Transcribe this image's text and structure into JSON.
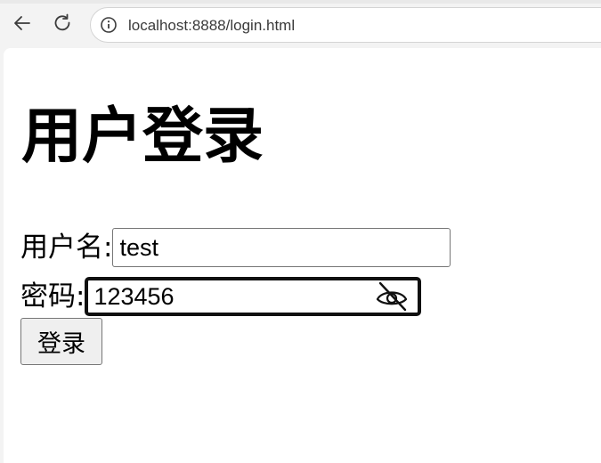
{
  "browser": {
    "url": "localhost:8888/login.html"
  },
  "page": {
    "title": "用户登录"
  },
  "form": {
    "username_label": "用户名:",
    "username_value": "test",
    "password_label": "密码:",
    "password_value": "123456",
    "submit_label": "登录"
  },
  "icons": {
    "back": "arrow-left-icon",
    "reload": "reload-icon",
    "site_info": "info-icon",
    "reveal_password": "eye-slash-icon"
  }
}
